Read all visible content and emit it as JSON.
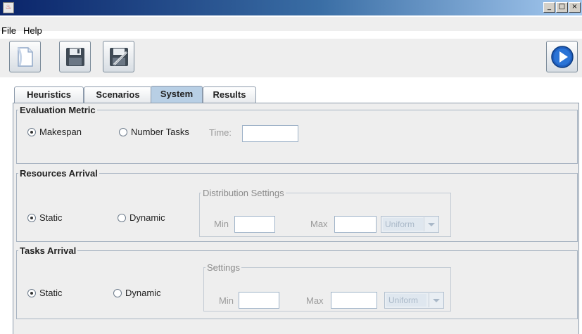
{
  "window": {
    "buttons": [
      {
        "name": "minimize-button",
        "glyph": "_"
      },
      {
        "name": "maximize-button",
        "glyph": "□"
      },
      {
        "name": "close-button",
        "glyph": "×"
      }
    ]
  },
  "menu": {
    "file": "File",
    "help": "Help"
  },
  "toolbar": {
    "icons": [
      "new-file-icon",
      "save-icon",
      "save-as-icon",
      "run-icon"
    ]
  },
  "tabs": [
    {
      "label": "Heuristics",
      "active": false
    },
    {
      "label": "Scenarios",
      "active": false
    },
    {
      "label": "System",
      "active": true
    },
    {
      "label": "Results",
      "active": false
    }
  ],
  "evaluation": {
    "title": "Evaluation Metric",
    "makespan": "Makespan",
    "number_tasks": "Number Tasks",
    "time_label": "Time:",
    "selected": "Makespan",
    "time_value": ""
  },
  "resources": {
    "title": "Resources Arrival",
    "static": "Static",
    "dynamic": "Dynamic",
    "selected": "Static",
    "dist_title": "Distribution Settings",
    "min_label": "Min",
    "max_label": "Max",
    "min_value": "",
    "max_value": "",
    "distribution": "Uniform"
  },
  "tasks": {
    "title": "Tasks Arrival",
    "static": "Static",
    "dynamic": "Dynamic",
    "selected": "Static",
    "settings_title": "Settings",
    "min_label": "Min",
    "max_label": "Max",
    "min_value": "",
    "max_value": "",
    "distribution": "Uniform"
  },
  "colors": {
    "titlebar_start": "#0a246a",
    "active_tab": "#b8cfe5",
    "panel_bg": "#eeeeee",
    "run_icon": "#1f5fbf"
  }
}
